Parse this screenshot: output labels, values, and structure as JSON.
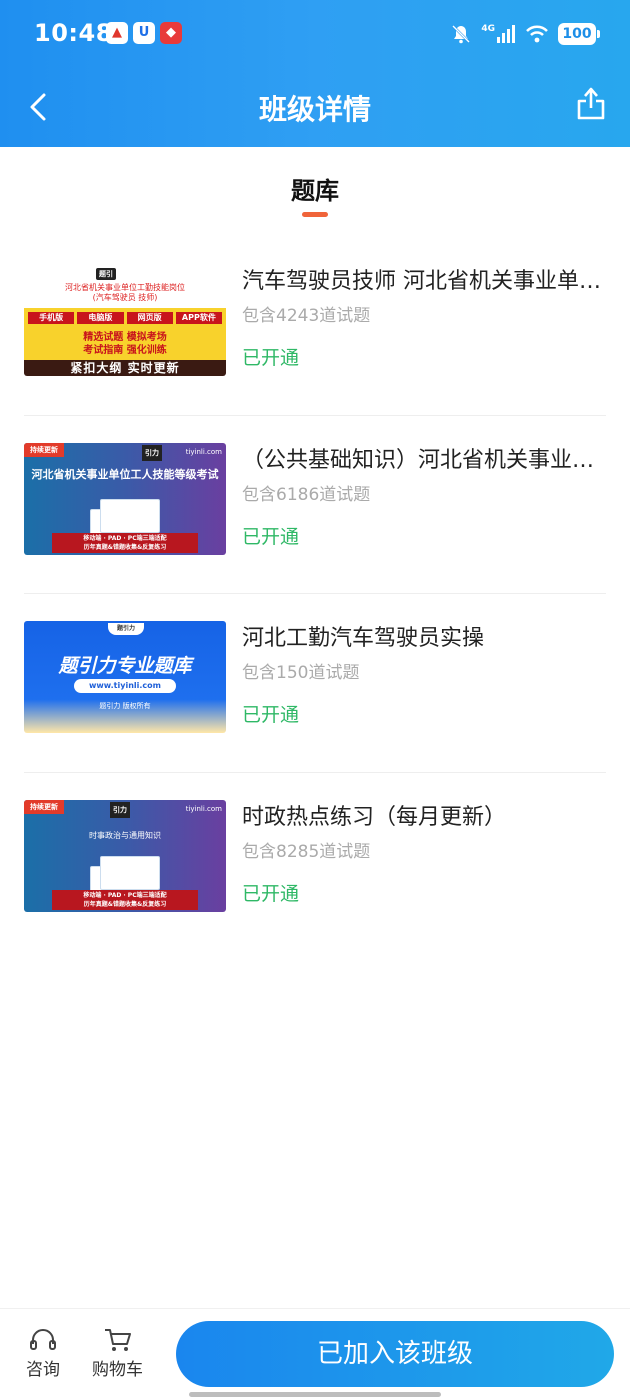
{
  "status_bar": {
    "time": "10:48",
    "battery": "100",
    "network": "4G"
  },
  "navbar": {
    "title": "班级详情"
  },
  "tab": {
    "label": "题库"
  },
  "courses": [
    {
      "name": "汽车驾驶员技师 河北省机关事业单位工勤技能岗位",
      "count": "包含4243道试题",
      "status": "已开通",
      "thumb": {
        "logo": "题引力",
        "line1": "河北省机关事业单位工勤技能岗位",
        "line2": "(汽车驾驶员 技师)",
        "tags": [
          "手机版",
          "电脑版",
          "网页版",
          "APP软件"
        ],
        "row2": "精选试题  模拟考场",
        "row3": "考试指南  强化训练",
        "bottom": "紧扣大纲 实时更新"
      }
    },
    {
      "name": "（公共基础知识）河北省机关事业单位工人技能等级考试",
      "count": "包含6186道试题",
      "status": "已开通",
      "thumb": {
        "badge": "持续更新",
        "site": "tiyinli.com",
        "heading": "河北省机关事业单位工人技能等级考试",
        "bar1": "移动端 · PAD · PC端三端适配",
        "bar2": "历年真题&错题收集&反复练习"
      }
    },
    {
      "name": "河北工勤汽车驾驶员实操",
      "count": "包含150道试题",
      "status": "已开通",
      "thumb": {
        "logo": "题引力",
        "heading": "题引力专业题库",
        "url": "www.tiyinli.com",
        "copyright": "题引力 版权所有"
      }
    },
    {
      "name": "时政热点练习（每月更新）",
      "count": "包含8285道试题",
      "status": "已开通",
      "thumb": {
        "badge": "持续更新",
        "site": "tiyinli.com",
        "heading": "时事政治与通用知识",
        "bar1": "移动端 · PAD · PC端三端适配",
        "bar2": "历年真题&错题收集&反复练习"
      }
    }
  ],
  "bottom_bar": {
    "consult_label": "咨询",
    "cart_label": "购物车",
    "join_label": "已加入该班级"
  },
  "colors": {
    "header": "#2196f3",
    "accent_status": "#2fb866",
    "tab_indicator": "#f0643a"
  }
}
